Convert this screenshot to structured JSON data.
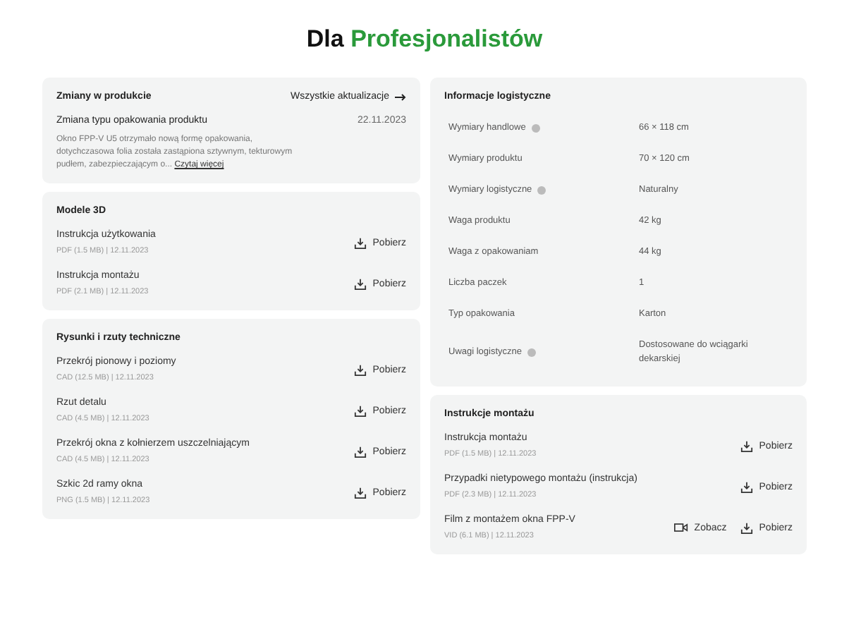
{
  "heading": {
    "lead": "Dla",
    "accent": "Profesjonalistów"
  },
  "changes": {
    "title": "Zmiany w produkcie",
    "all_link": "Wszystkie aktualizacje",
    "item": {
      "title": "Zmiana typu opakowania produktu",
      "date": "22.11.2023",
      "text": "Okno FPP-V U5 otrzymało nową formę opakowania, dotychczasowa folia została zastąpiona sztywnym, tekturowym pudłem, zabezpieczającym o...",
      "more": "Czytaj więcej"
    }
  },
  "models": {
    "title": "Modele 3D",
    "files": [
      {
        "name": "Instrukcja użytkowania",
        "meta": "PDF (1.5 MB) | 12.11.2023",
        "actions": [
          {
            "kind": "download",
            "label": "Pobierz"
          }
        ]
      },
      {
        "name": "Instrukcja montażu",
        "meta": "PDF (2.1 MB) | 12.11.2023",
        "actions": [
          {
            "kind": "download",
            "label": "Pobierz"
          }
        ]
      }
    ]
  },
  "drawings": {
    "title": "Rysunki i rzuty techniczne",
    "files": [
      {
        "name": "Przekrój pionowy i poziomy",
        "meta": "CAD (12.5 MB) | 12.11.2023",
        "actions": [
          {
            "kind": "download",
            "label": "Pobierz"
          }
        ]
      },
      {
        "name": "Rzut detalu",
        "meta": "CAD (4.5 MB) | 12.11.2023",
        "actions": [
          {
            "kind": "download",
            "label": "Pobierz"
          }
        ]
      },
      {
        "name": "Przekrój okna  z kołnierzem uszczelniającym",
        "meta": "CAD (4.5 MB) | 12.11.2023",
        "actions": [
          {
            "kind": "download",
            "label": "Pobierz"
          }
        ]
      },
      {
        "name": "Szkic 2d ramy okna",
        "meta": "PNG (1.5 MB) | 12.11.2023",
        "actions": [
          {
            "kind": "download",
            "label": "Pobierz"
          }
        ]
      }
    ]
  },
  "logistics": {
    "title": "Informacje logistyczne",
    "rows": [
      {
        "label": "Wymiary handlowe",
        "info": true,
        "value": "66 × 118 cm"
      },
      {
        "label": "Wymiary produktu",
        "info": false,
        "value": "70 × 120 cm"
      },
      {
        "label": "Wymiary logistyczne",
        "info": true,
        "value": "Naturalny"
      },
      {
        "label": "Waga produktu",
        "info": false,
        "value": "42 kg"
      },
      {
        "label": "Waga z opakowaniam",
        "info": false,
        "value": "44 kg"
      },
      {
        "label": "Liczba paczek",
        "info": false,
        "value": "1"
      },
      {
        "label": "Typ opakowania",
        "info": false,
        "value": "Karton"
      },
      {
        "label": "Uwagi logistyczne",
        "info": true,
        "value": "Dostosowane do wciągarki dekarskiej"
      }
    ]
  },
  "assembly": {
    "title": "Instrukcje montażu",
    "files": [
      {
        "name": "Instrukcja montażu",
        "meta": "PDF (1.5 MB) | 12.11.2023",
        "actions": [
          {
            "kind": "download",
            "label": "Pobierz"
          }
        ]
      },
      {
        "name": "Przypadki nietypowego montażu (instrukcja)",
        "meta": "PDF (2.3 MB) | 12.11.2023",
        "actions": [
          {
            "kind": "download",
            "label": "Pobierz"
          }
        ]
      },
      {
        "name": "Film z montażem okna FPP-V",
        "meta": "VID (6.1 MB) | 12.11.2023",
        "actions": [
          {
            "kind": "view",
            "label": "Zobacz"
          },
          {
            "kind": "download",
            "label": "Pobierz"
          }
        ]
      }
    ]
  }
}
